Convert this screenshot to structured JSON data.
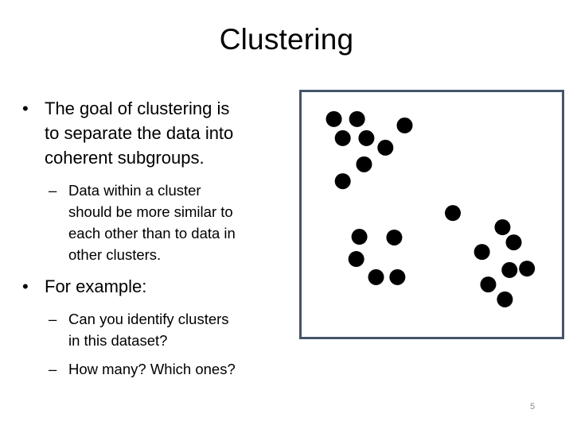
{
  "slide": {
    "title": "Clustering",
    "page_number": "5"
  },
  "bullets": [
    {
      "lines": [
        "The goal of clustering is",
        "to separate the data into",
        "coherent subgroups."
      ],
      "bullet_glyph": "•",
      "sub": [
        {
          "dash": "–",
          "lines": [
            "Data within a cluster",
            "should be more similar to",
            "each other than to data in",
            "other clusters."
          ]
        }
      ]
    },
    {
      "lines": [
        "For example:"
      ],
      "bullet_glyph": "•",
      "sub": [
        {
          "dash": "–",
          "lines": [
            "Can you identify clusters",
            "in this dataset?"
          ]
        },
        {
          "dash": "–",
          "lines": [
            "How many? Which ones?"
          ]
        }
      ]
    }
  ],
  "chart_data": {
    "type": "scatter",
    "title": "",
    "xlabel": "",
    "ylabel": "",
    "axes_visible": false,
    "grid": false,
    "xlim": [
      0,
      100
    ],
    "ylim": [
      0,
      100
    ],
    "marker_color": "#000000",
    "frame_color": "#44546a",
    "points": [
      {
        "x": 12.4,
        "y": 89.0
      },
      {
        "x": 21.3,
        "y": 89.0
      },
      {
        "x": 39.6,
        "y": 86.4
      },
      {
        "x": 15.8,
        "y": 81.2
      },
      {
        "x": 24.9,
        "y": 81.2
      },
      {
        "x": 32.2,
        "y": 77.3
      },
      {
        "x": 24.0,
        "y": 70.5
      },
      {
        "x": 15.8,
        "y": 63.6
      },
      {
        "x": 22.2,
        "y": 40.9
      },
      {
        "x": 35.6,
        "y": 40.6
      },
      {
        "x": 21.0,
        "y": 31.8
      },
      {
        "x": 28.6,
        "y": 24.4
      },
      {
        "x": 36.8,
        "y": 24.4
      },
      {
        "x": 58.1,
        "y": 50.6
      },
      {
        "x": 77.2,
        "y": 44.8
      },
      {
        "x": 81.5,
        "y": 38.6
      },
      {
        "x": 69.3,
        "y": 34.7
      },
      {
        "x": 79.9,
        "y": 27.3
      },
      {
        "x": 86.6,
        "y": 27.9
      },
      {
        "x": 71.7,
        "y": 21.4
      },
      {
        "x": 78.1,
        "y": 15.3
      }
    ]
  }
}
